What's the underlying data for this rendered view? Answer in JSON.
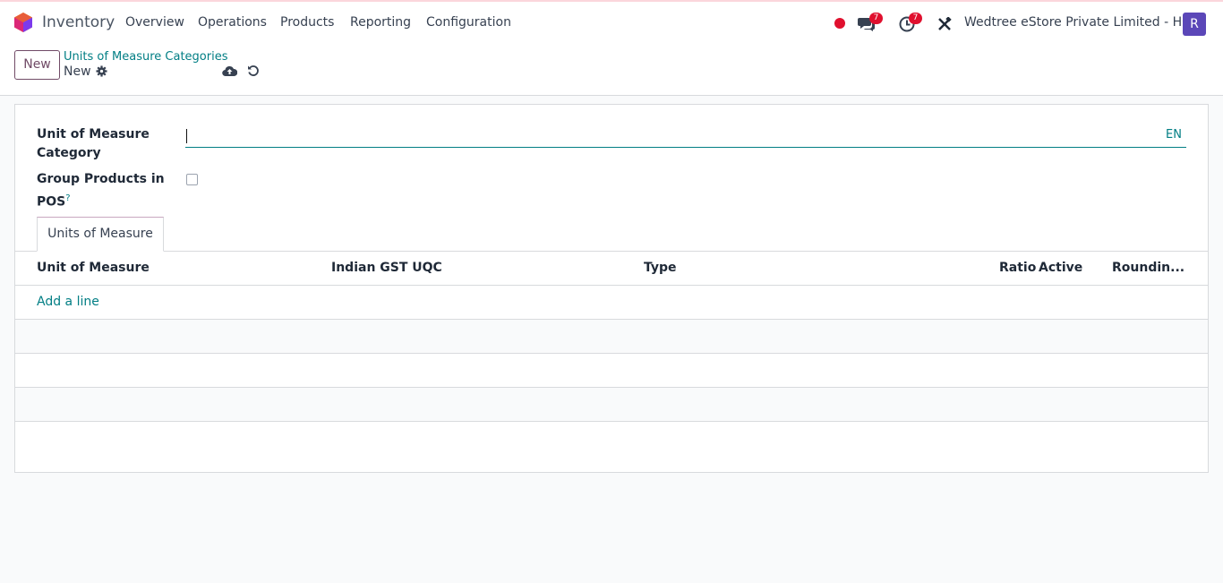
{
  "app": {
    "name": "Inventory",
    "menu": [
      "Overview",
      "Operations",
      "Products",
      "Reporting",
      "Configuration"
    ]
  },
  "systray": {
    "messages_count": "7",
    "activities_count": "7",
    "company": "Wedtree eStore Private Limited - HO",
    "avatar_letter": "R"
  },
  "control_panel": {
    "new_label": "New",
    "breadcrumb_parent": "Units of Measure Categories",
    "breadcrumb_current": "New"
  },
  "form": {
    "category_label_line1": "Unit of Measure",
    "category_label_line2": "Category",
    "category_value": "",
    "lang": "EN",
    "group_label_line1": "Group Products in",
    "group_label_line2": "POS",
    "group_help": "?",
    "group_checked": false
  },
  "tabs": [
    "Units of Measure"
  ],
  "table": {
    "columns": [
      "Unit of Measure",
      "Indian GST UQC",
      "Type",
      "Ratio",
      "Active",
      "Roundin..."
    ],
    "add_line": "Add a line"
  },
  "colors": {
    "brand": "#714b67",
    "link": "#017e84",
    "badge": "#e0102e",
    "avatar": "#5b47b8"
  }
}
